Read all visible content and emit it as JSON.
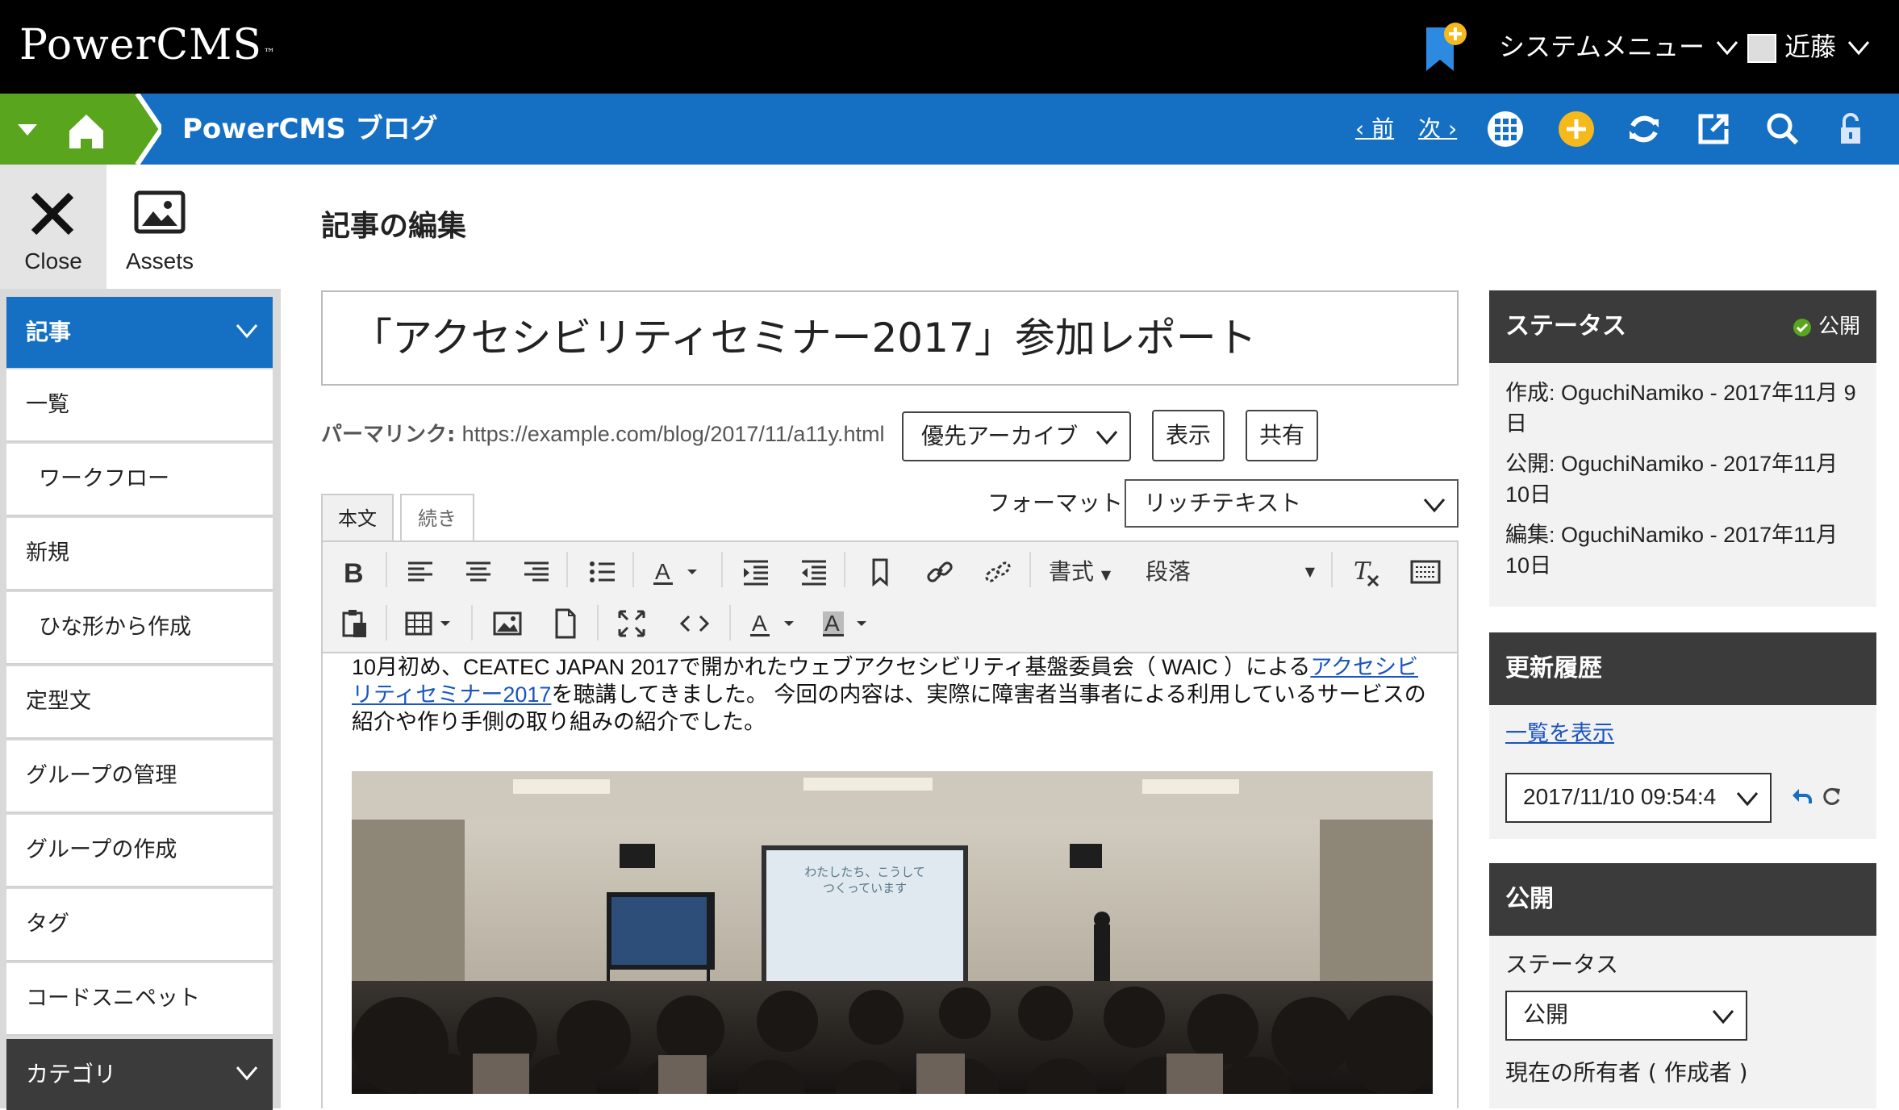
{
  "app": {
    "logo": "PowerCMS",
    "logo_tm": "™",
    "system_menu": "システムメニュー",
    "user_name": "近藤"
  },
  "site": {
    "title": "PowerCMS ブログ",
    "prev": "‹ 前",
    "next": "次 ›"
  },
  "quick": {
    "close_label": "Close",
    "assets_label": "Assets"
  },
  "sidebar": {
    "section_title": "記事",
    "items": [
      {
        "label": "一覧"
      },
      {
        "label": "ワークフロー"
      },
      {
        "label": "新規"
      },
      {
        "label": "ひな形から作成"
      },
      {
        "label": "定型文"
      },
      {
        "label": "グループの管理"
      },
      {
        "label": "グループの作成"
      },
      {
        "label": "タグ"
      },
      {
        "label": "コードスニペット"
      }
    ],
    "next_section": "カテゴリ"
  },
  "main": {
    "page_title": "記事の編集",
    "entry_title": "「アクセシビリティセミナー2017」参加レポート",
    "permalink_label": "パーマリンク:",
    "permalink_url": "https://example.com/blog/2017/11/a11y.html",
    "archive_select": "優先アーカイブ",
    "view_button": "表示",
    "share_button": "共有",
    "tab_body": "本文",
    "tab_more": "続き",
    "format_label": "フォーマット:",
    "format_value": "リッチテキスト",
    "toolbar": {
      "format_menu": "書式",
      "paragraph_menu": "段落"
    },
    "body_before_link": "10月初め、CEATEC JAPAN 2017で開かれたウェブアクセシビリティ基盤委員会（ WAIC ）による",
    "body_link": "アクセシビリティセミナー2017",
    "body_after_link": "を聴講してきました。 今回の内容は、実際に障害者当事者による利用しているサービスの紹介や作り手側の取り組みの紹介でした。",
    "photo_screen_line1": "わたしたち、こうして",
    "photo_screen_line2": "つくっています"
  },
  "status_panel": {
    "title": "ステータス",
    "badge": "公開",
    "created": "作成: OguchiNamiko - 2017年11月 9日",
    "published": "公開: OguchiNamiko - 2017年11月10日",
    "edited": "編集: OguchiNamiko - 2017年11月10日"
  },
  "history_panel": {
    "title": "更新履歴",
    "view_list": "一覧を表示",
    "revision": "2017/11/10 09:54:4"
  },
  "publish_panel": {
    "title": "公開",
    "status_label": "ステータス",
    "status_value": "公開",
    "owner_label": "現在の所有者 ( 作成者 )"
  },
  "colors": {
    "topbar": "#000000",
    "bluebar": "#1570c4",
    "green": "#5aa51e",
    "nav_active": "#1570c4",
    "nav_section": "#3b3b3b",
    "panel_head": "#3b3b3b",
    "accent_yellow": "#f5b91c"
  }
}
